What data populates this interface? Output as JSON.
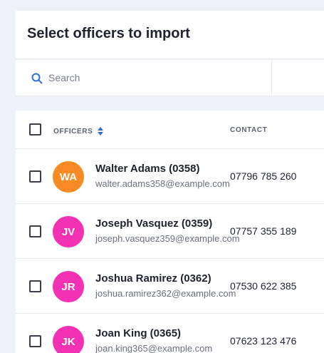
{
  "title": "Select officers to import",
  "search": {
    "placeholder": "Search",
    "value": ""
  },
  "table": {
    "columns": {
      "officers": "OFFICERS",
      "contact": "CONTACT"
    },
    "rows": [
      {
        "initials": "WA",
        "avatar_color": "#f78a22",
        "name": "Walter Adams (0358)",
        "email": "walter.adams358@example.com",
        "phone": "07796 785 260",
        "checked": false
      },
      {
        "initials": "JV",
        "avatar_color": "#f231b5",
        "name": "Joseph Vasquez (0359)",
        "email": "joseph.vasquez359@example.com",
        "phone": "07757 355 189",
        "checked": false
      },
      {
        "initials": "JR",
        "avatar_color": "#f231b5",
        "name": "Joshua Ramirez (0362)",
        "email": "joshua.ramirez362@example.com",
        "phone": "07530 622 385",
        "checked": false
      },
      {
        "initials": "JK",
        "avatar_color": "#f231b5",
        "name": "Joan King (0365)",
        "email": "joan.king365@example.com",
        "phone": "07623 123 476",
        "checked": false
      }
    ]
  },
  "colors": {
    "accent": "#2f6fdb",
    "background": "#eef1f7"
  }
}
